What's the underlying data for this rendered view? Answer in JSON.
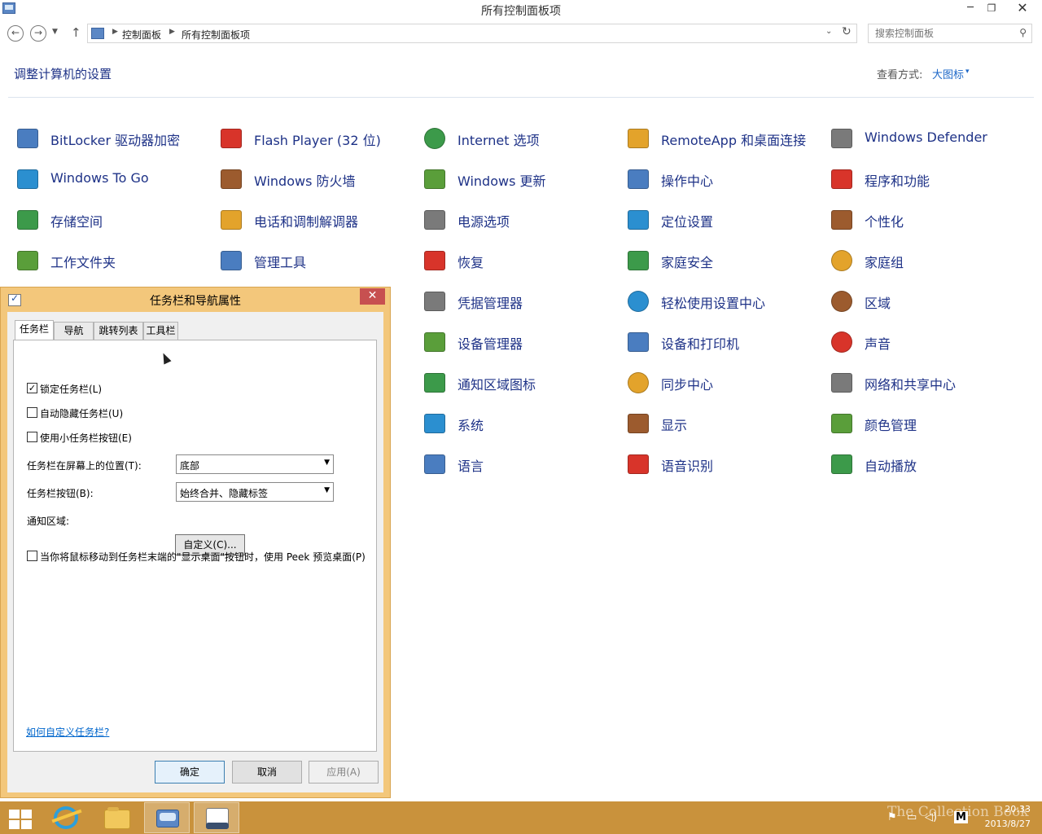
{
  "window": {
    "title": "所有控制面板项",
    "minimize_glyph": "─",
    "maximize_glyph": "❐",
    "close_glyph": "✕"
  },
  "address": {
    "back_glyph": "←",
    "forward_glyph": "→",
    "recent_glyph": "▼",
    "up_glyph": "↑",
    "breadcrumbs": [
      "控制面板",
      "所有控制面板项"
    ],
    "dropdown_glyph": "⌄",
    "refresh_glyph": "↻"
  },
  "search": {
    "placeholder": "搜索控制面板",
    "icon": "magnifier-icon"
  },
  "header": {
    "title": "调整计算机的设置",
    "view_by_label": "查看方式:",
    "view_by_value": "大图标",
    "view_by_arrow": "▾"
  },
  "items": [
    {
      "label": "BitLocker 驱动器加密",
      "icon": "keys-icon"
    },
    {
      "label": "Flash Player (32 位)",
      "icon": "flash-icon"
    },
    {
      "label": "Internet 选项",
      "icon": "globe-icon"
    },
    {
      "label": "RemoteApp 和桌面连接",
      "icon": "monitor-icon"
    },
    {
      "label": "Windows Defender",
      "icon": "castle-wall-icon"
    },
    {
      "label": "Windows To Go",
      "icon": "usb-drive-icon"
    },
    {
      "label": "Windows 防火墙",
      "icon": "brick-wall-icon"
    },
    {
      "label": "Windows 更新",
      "icon": "update-icon"
    },
    {
      "label": "操作中心",
      "icon": "flag-icon"
    },
    {
      "label": "程序和功能",
      "icon": "programs-icon"
    },
    {
      "label": "存储空间",
      "icon": "stack-disks-icon"
    },
    {
      "label": "电话和调制解调器",
      "icon": "phone-icon"
    },
    {
      "label": "电源选项",
      "icon": "battery-icon"
    },
    {
      "label": "定位设置",
      "icon": "location-map-icon"
    },
    {
      "label": "个性化",
      "icon": "personalize-icon"
    },
    {
      "label": "工作文件夹",
      "icon": "folder-icon"
    },
    {
      "label": "管理工具",
      "icon": "gear-icon"
    },
    {
      "label": "恢复",
      "icon": "recovery-icon"
    },
    {
      "label": "家庭安全",
      "icon": "family-icon"
    },
    {
      "label": "家庭组",
      "icon": "homegroup-icon"
    },
    {
      "label": "凭据管理器",
      "icon": "safe-icon"
    },
    {
      "label": "轻松使用设置中心",
      "icon": "ease-of-access-icon"
    },
    {
      "label": "区域",
      "icon": "globe-clock-icon"
    },
    {
      "label": "设备管理器",
      "icon": "device-manager-icon"
    },
    {
      "label": "设备和打印机",
      "icon": "printer-icon"
    },
    {
      "label": "声音",
      "icon": "speaker-icon"
    },
    {
      "label": "通知区域图标",
      "icon": "tray-icon"
    },
    {
      "label": "同步中心",
      "icon": "sync-icon"
    },
    {
      "label": "网络和共享中心",
      "icon": "network-icon"
    },
    {
      "label": "系统",
      "icon": "computer-icon"
    },
    {
      "label": "显示",
      "icon": "display-icon"
    },
    {
      "label": "颜色管理",
      "icon": "color-icon"
    },
    {
      "label": "语言",
      "icon": "language-icon"
    },
    {
      "label": "语音识别",
      "icon": "microphone-icon"
    },
    {
      "label": "自动播放",
      "icon": "autoplay-icon"
    }
  ],
  "dialog": {
    "title": "任务栏和导航属性",
    "close_glyph": "✕",
    "tabs": [
      "任务栏",
      "导航",
      "跳转列表",
      "工具栏"
    ],
    "checkboxes": [
      {
        "label": "锁定任务栏(L)",
        "checked": true,
        "mark": "✓"
      },
      {
        "label": "自动隐藏任务栏(U)",
        "checked": false,
        "mark": ""
      },
      {
        "label": "使用小任务栏按钮(E)",
        "checked": false,
        "mark": ""
      }
    ],
    "position_label": "任务栏在屏幕上的位置(T):",
    "position_value": "底部",
    "buttons_label": "任务栏按钮(B):",
    "buttons_value": "始终合并、隐藏标签",
    "combo_arrow": "▼",
    "notify_label": "通知区域:",
    "customize_label": "自定义(C)...",
    "peek_label": "当你将鼠标移动到任务栏末端的\"显示桌面\"按钮时，使用 Peek 预览桌面(P)",
    "peek_checked": false,
    "help_link": "如何自定义任务栏?",
    "ok_label": "确定",
    "cancel_label": "取消",
    "apply_label": "应用(A)"
  },
  "taskbar": {
    "watermark": "The Collection Book",
    "time": "20:33",
    "date": "2013/8/27",
    "tray_glyphs": [
      "⚑",
      "▭",
      "◁)",
      "M"
    ],
    "accent": "#c9923c"
  }
}
